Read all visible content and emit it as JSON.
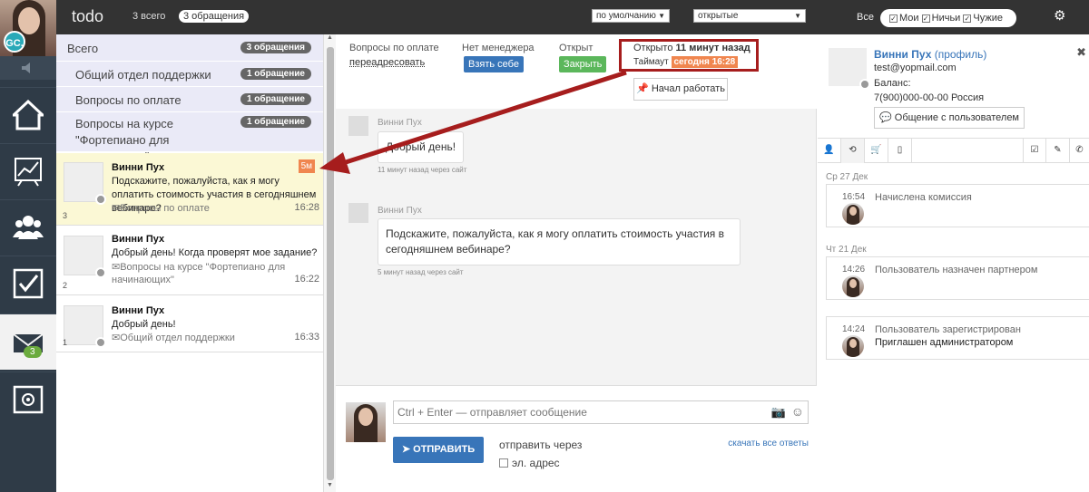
{
  "topbar": {
    "title": "todo",
    "total": "3 всего",
    "pill": "3 обращения",
    "sort": "по умолчанию",
    "filter": "открытые",
    "all": "Все",
    "mine": "Мои",
    "nobody": "Ничьи",
    "others": "Чужие"
  },
  "leftnav": {
    "avatar_initials": "GC.",
    "mail_badge": "3"
  },
  "groups": [
    {
      "label": "Всего",
      "count": "3 обращения"
    },
    {
      "label": "Общий отдел поддержки",
      "count": "1 обращение"
    },
    {
      "label": "Вопросы по оплате",
      "count": "1 обращение"
    },
    {
      "label": "Вопросы на курсе \"Фортепиано для начинающих\"",
      "count": "1 обращение"
    }
  ],
  "conversations": [
    {
      "name": "Винни Пух",
      "text": "Подскажите, пожалуйста, как я могу оплатить стоимость участия в сегодняшнем вебинаре?",
      "dept": "Вопросы по оплате",
      "time": "16:28",
      "num": "3",
      "badge": "5м"
    },
    {
      "name": "Винни Пух",
      "text": "Добрый день! Когда проверят мое задание?",
      "dept": "Вопросы на курсе \"Фортепиано для начинающих\"",
      "time": "16:22",
      "num": "2"
    },
    {
      "name": "Винни Пух",
      "text": "Добрый день!",
      "dept": "Общий отдел поддержки",
      "time": "16:33",
      "num": "1"
    }
  ],
  "header": {
    "topic_label": "Вопросы по оплате",
    "redirect": "переадресовать",
    "no_manager": "Нет менеджера",
    "take": "Взять себе",
    "open_label": "Открыт",
    "close": "Закрыть",
    "opened_prefix": "Открыто",
    "opened_value": "11 минут назад",
    "timeout_label": "Таймаут",
    "timeout_value": "сегодня 16:28",
    "start_work": "Начал работать"
  },
  "messages": [
    {
      "name": "Винни Пух",
      "text": "Добрый день!",
      "meta": "11 минут назад через сайт"
    },
    {
      "name": "Винни Пух",
      "text": "Подскажите, пожалуйста, как я могу оплатить стоимость участия в сегодняшнем вебинаре?",
      "meta": "5 минут назад через сайт"
    }
  ],
  "compose": {
    "placeholder": "Ctrl + Enter — отправляет сообщение",
    "send": "ОТПРАВИТЬ",
    "send_via": "отправить через",
    "download": "скачать все ответы",
    "email": "эл. адрес"
  },
  "profile": {
    "name": "Винни Пух",
    "profile_link": "(профиль)",
    "email": "test@yopmail.com",
    "balance": "Баланс:",
    "phone": "7(900)000-00-00 Россия",
    "chat_button": "Общение с пользователем"
  },
  "timeline": [
    {
      "day": "Ср 27 Дек",
      "time": "16:54",
      "text": "Начислена комиссия",
      "text2": ""
    },
    {
      "day": "Чт 21 Дек",
      "time": "14:26",
      "text": "Пользователь назначен партнером",
      "text2": ""
    },
    {
      "day": "",
      "time": "14:24",
      "text": "Пользователь зарегистрирован",
      "text2": "Приглашен администратором"
    }
  ],
  "colors": {
    "accent": "#3875b9",
    "success": "#5bb75b",
    "warning": "#f0864f",
    "annotation": "#a61d1d"
  }
}
